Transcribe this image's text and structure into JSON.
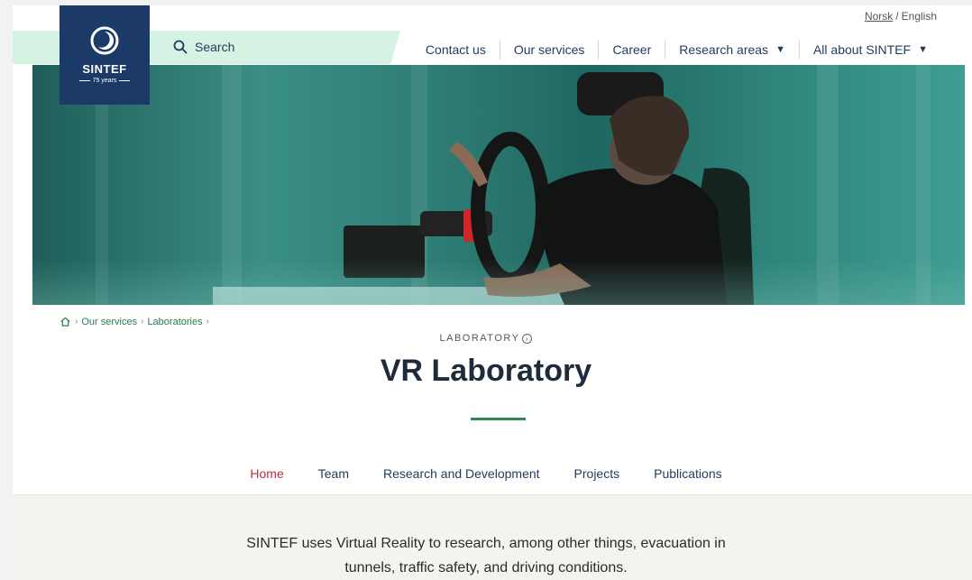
{
  "lang": {
    "norsk": "Norsk",
    "separator": "/",
    "english": "English"
  },
  "logo": {
    "name": "SINTEF",
    "years": "75 years"
  },
  "search": {
    "label": "Search"
  },
  "nav": {
    "items": [
      {
        "label": "Contact us"
      },
      {
        "label": "Our services"
      },
      {
        "label": "Career"
      },
      {
        "label": "Research areas",
        "caret": "▼"
      },
      {
        "label": "All about SINTEF",
        "caret": "▼"
      }
    ]
  },
  "breadcrumb": {
    "items": [
      "Our services",
      "Laboratories"
    ],
    "separator": "›"
  },
  "eyebrow": {
    "label": "LABORATORY"
  },
  "title": "VR Laboratory",
  "tabs": [
    {
      "label": "Home",
      "active": true
    },
    {
      "label": "Team"
    },
    {
      "label": "Research and Development"
    },
    {
      "label": "Projects"
    },
    {
      "label": "Publications"
    }
  ],
  "intro": {
    "line1": "SINTEF uses Virtual Reality to research, among other things, evacuation in",
    "line2": "tunnels, traffic safety, and driving conditions."
  },
  "colors": {
    "brand_navy": "#1b3a68",
    "accent_green": "#2d8a57",
    "active_tab": "#b3333c",
    "search_band": "#d5f3e2"
  }
}
